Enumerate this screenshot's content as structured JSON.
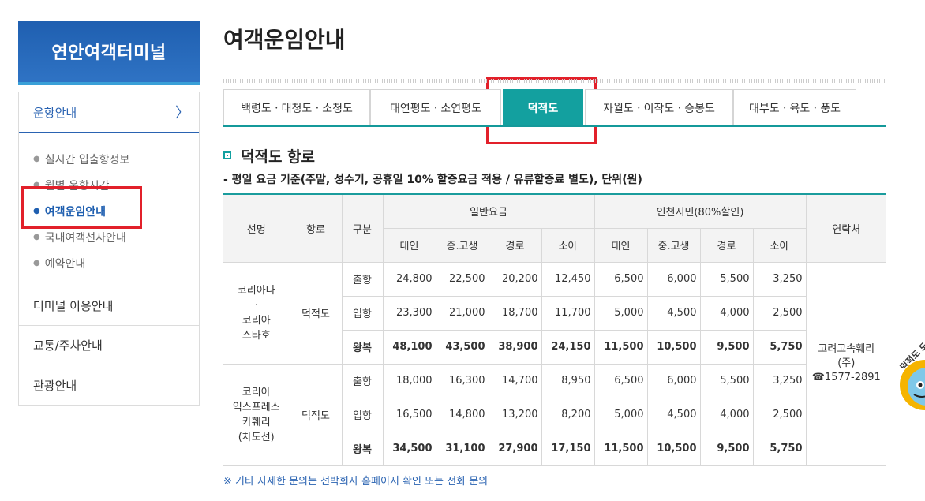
{
  "sidebar": {
    "header": "연안여객터미널",
    "section": "운항안내",
    "chevron": "〉",
    "submenu": [
      "실시간 입출항정보",
      "월별 운항시간",
      "여객운임안내",
      "국내여객선사안내",
      "예약안내"
    ],
    "menu": [
      "터미널 이용안내",
      "교통/주차안내",
      "관광안내"
    ]
  },
  "main": {
    "title": "여객운임안내",
    "tabs": [
      "백령도ㆍ대청도ㆍ소청도",
      "대연평도ㆍ소연평도",
      "덕적도",
      "자월도ㆍ이작도ㆍ승봉도",
      "대부도ㆍ육도ㆍ풍도"
    ],
    "section_title": "덕적도 항로",
    "note_top": "- 평일 요금 기준(주말, 성수기, 공휴일 10% 할증요금 적용 / 유류할증료 별도), 단위(원)",
    "note_bottom": "※ 기타 자세한 문의는 선박회사 홈페이지 확인 또는 전화 문의"
  },
  "table": {
    "head": {
      "ship": "선명",
      "route": "항로",
      "type": "구분",
      "general": "일반요금",
      "citizen": "인천시민(80%할인)",
      "contact": "연락처",
      "sub": [
        "대인",
        "중.고생",
        "경로",
        "소아",
        "대인",
        "중.고생",
        "경로",
        "소아"
      ]
    },
    "groups": [
      {
        "ship": [
          "코리아나",
          "ㆍ",
          "코리아",
          "스타호"
        ],
        "route": "덕적도",
        "rows": [
          {
            "type": "출항",
            "vals": [
              "24,800",
              "22,500",
              "20,200",
              "12,450",
              "6,500",
              "6,000",
              "5,500",
              "3,250"
            ]
          },
          {
            "type": "입항",
            "vals": [
              "23,300",
              "21,000",
              "18,700",
              "11,700",
              "5,000",
              "4,500",
              "4,000",
              "2,500"
            ]
          },
          {
            "type": "왕복",
            "vals": [
              "48,100",
              "43,500",
              "38,900",
              "24,150",
              "11,500",
              "10,500",
              "9,500",
              "5,750"
            ]
          }
        ]
      },
      {
        "ship": [
          "코리아",
          "익스프레스",
          "카훼리",
          "(차도선)"
        ],
        "route": "덕적도",
        "rows": [
          {
            "type": "출항",
            "vals": [
              "18,000",
              "16,300",
              "14,700",
              "8,950",
              "6,500",
              "6,000",
              "5,500",
              "3,250"
            ]
          },
          {
            "type": "입항",
            "vals": [
              "16,500",
              "14,800",
              "13,200",
              "8,200",
              "5,000",
              "4,500",
              "4,000",
              "2,500"
            ]
          },
          {
            "type": "왕복",
            "vals": [
              "34,500",
              "31,100",
              "27,900",
              "17,150",
              "11,500",
              "10,500",
              "9,500",
              "5,750"
            ]
          }
        ]
      }
    ],
    "contact": {
      "line1": "고려고속훼리",
      "line2": "(주)",
      "phone_icon": "☎",
      "phone": "1577-2891"
    }
  },
  "colors": {
    "brand_blue": "#1f5fb0",
    "teal": "#13a09f",
    "highlight_red": "#e2202a"
  },
  "mascot_label": "덕적도 도우미"
}
